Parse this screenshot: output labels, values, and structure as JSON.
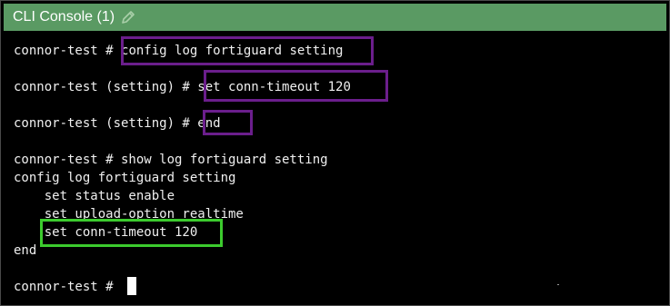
{
  "window": {
    "title": "CLI Console (1)",
    "titlebar_color": "#5a9a63",
    "terminal_background": "#000000",
    "text_color": "#f0f0f0"
  },
  "icons": {
    "edit": "pencil-icon"
  },
  "highlight_colors": {
    "command_box": "#6b1e8c",
    "result_box": "#3ccb2e"
  },
  "terminal": {
    "lines": [
      {
        "prompt": "connor-test # ",
        "command": "config log fortiguard setting"
      },
      {
        "prompt": "connor-test (setting) # ",
        "command": "set conn-timeout 120"
      },
      {
        "prompt": "connor-test (setting) # ",
        "command": "end"
      },
      {
        "text": "connor-test # show log fortiguard setting"
      },
      {
        "text": "config log fortiguard setting"
      },
      {
        "text": "    set status enable"
      },
      {
        "text": "    set upload-option realtime"
      },
      {
        "text": "    set conn-timeout 120"
      },
      {
        "text": "end"
      },
      {
        "text": "connor-test # "
      }
    ]
  }
}
